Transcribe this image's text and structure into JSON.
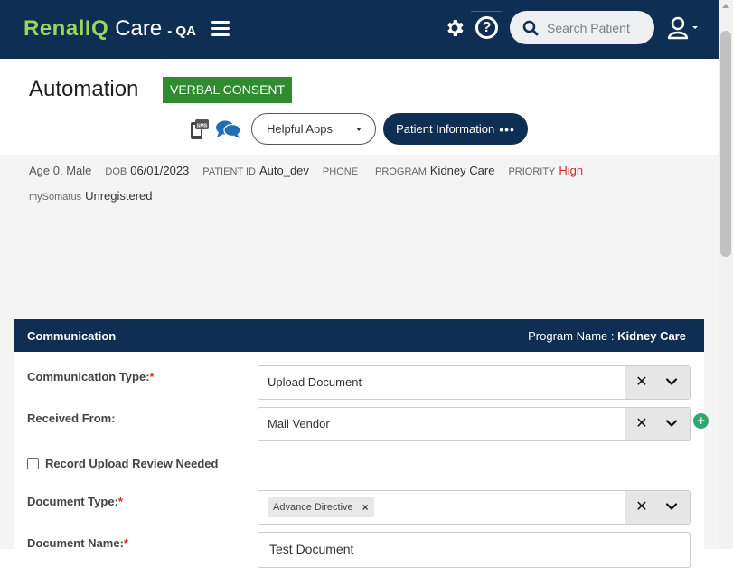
{
  "app": {
    "brand_main": "RenalIQ",
    "brand_care": "Care",
    "brand_env": "- QA"
  },
  "header": {
    "search_placeholder": "Search Patient",
    "icons": [
      "menu-icon",
      "gear-icon",
      "help-icon",
      "search-icon",
      "user-icon"
    ]
  },
  "patient": {
    "name": "Automation",
    "consent_badge": "VERBAL CONSENT",
    "helpful_apps_label": "Helpful Apps",
    "patient_info_label": "Patient Information",
    "patient_info_more": "•••",
    "age_sex": "Age 0, Male",
    "dob_label": "DOB",
    "dob": "06/01/2023",
    "patient_id_label": "PATIENT ID",
    "patient_id": "Auto_dev",
    "phone_label": "PHONE",
    "phone": "",
    "program_label": "PROGRAM",
    "program": "Kidney Care",
    "priority_label": "PRIORITY",
    "priority": "High",
    "mysomatus_label": "mySomatus",
    "mysomatus": "Unregistered"
  },
  "communication": {
    "title": "Communication",
    "program_name_label": "Program Name :",
    "program_name": "Kidney Care",
    "communication_type_label": "Communication Type:",
    "communication_type": "Upload Document",
    "received_from_label": "Received From:",
    "received_from": "Mail Vendor",
    "record_upload_label": "Record Upload Review Needed",
    "record_upload_checked": false,
    "document_type_label": "Document Type:",
    "document_type_chip": "Advance Directive",
    "document_name_label": "Document Name:",
    "document_name": "Test Document",
    "required_mark": "*"
  },
  "colors": {
    "nav": "#0e2f53",
    "brand_green": "#9fd45a",
    "consent_green": "#2e8b2e",
    "priority_red": "#d9262b",
    "add_green": "#2ea86d"
  }
}
